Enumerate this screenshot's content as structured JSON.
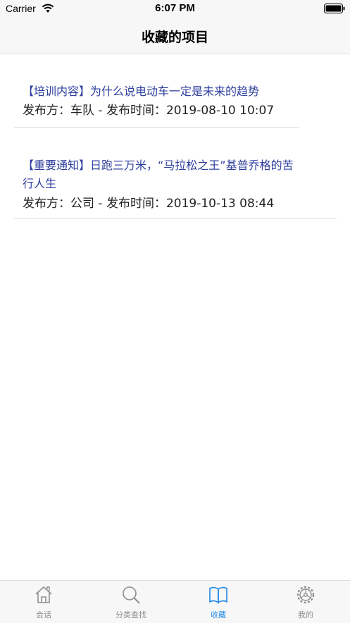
{
  "status_bar": {
    "carrier": "Carrier",
    "time": "6:07 PM"
  },
  "nav": {
    "title": "收藏的项目"
  },
  "items": [
    {
      "title_line1": "【培训内容】为什么说电动车一定是未来的趋势",
      "title_line2": "",
      "meta": "发布方：车队 - 发布时间：2019-08-10 10:07"
    },
    {
      "title_line1": "【重要通知】日跑三万米，“马拉松之王”基普乔格的苦",
      "title_line2": "行人生",
      "meta": "发布方：公司 - 发布时间：2019-10-13 08:44"
    }
  ],
  "tabs": [
    {
      "label": "会话",
      "icon": "house-icon",
      "active": false
    },
    {
      "label": "分类查找",
      "icon": "search-icon",
      "active": false
    },
    {
      "label": "收藏",
      "icon": "book-icon",
      "active": true
    },
    {
      "label": "我的",
      "icon": "gear-icon",
      "active": false
    }
  ],
  "colors": {
    "title_text": "#2f3f9e",
    "active_tab": "#1e88e5",
    "inactive_tab": "#8e8e8e",
    "bar_background": "#f7f7f7"
  }
}
